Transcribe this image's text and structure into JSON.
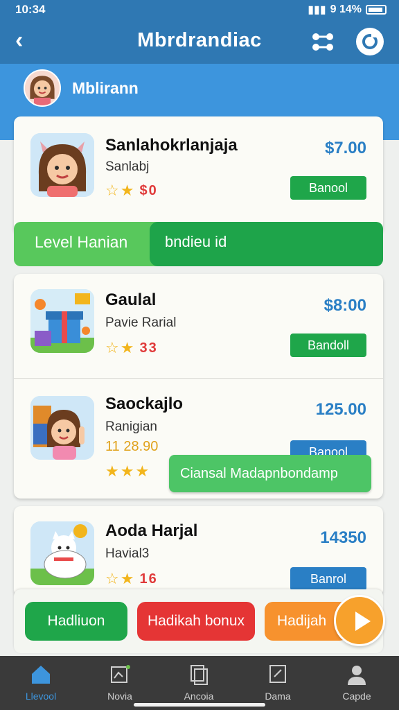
{
  "status": {
    "time": "10:34",
    "indicators": "9 14%"
  },
  "appbar": {
    "title": "Mbrdrandiac",
    "back_icon": "chevron-left-icon",
    "share_icon": "share-icon",
    "refresh_icon": "refresh-icon"
  },
  "profile": {
    "name": "Mblirann"
  },
  "items": [
    {
      "name": "Sanlahokrlanjaja",
      "subtitle": "Sanlabj",
      "price": "$7.00",
      "stars": 2,
      "rating": "$0",
      "button": "Banool"
    },
    {
      "name": "Gaulal",
      "subtitle": "Pavie Rarial",
      "price": "$8:00",
      "stars": 2,
      "rating": "33",
      "button": "Bandoll"
    },
    {
      "name": "Saockajlo",
      "subtitle": "Ranigian",
      "extra": "11 28.90",
      "price": "125.00",
      "stars": 3,
      "button": "Banool"
    },
    {
      "name": "Aoda Harjal",
      "subtitle": "Havial3",
      "price": "14350",
      "stars": 2,
      "rating": "16",
      "button": "Banrol"
    }
  ],
  "level": {
    "label": "Level Hanian",
    "value": "bndieu id"
  },
  "promo": {
    "text": "Ciansal Madapnbondamp"
  },
  "actions": {
    "btn1": "Hadliuon",
    "btn2": "Hadikah bonux",
    "btn3": "Hadijah"
  },
  "nav": [
    {
      "label": "Llevool",
      "icon": "home-icon",
      "active": true
    },
    {
      "label": "Novia",
      "icon": "chart-icon",
      "active": false
    },
    {
      "label": "Ancoia",
      "icon": "copy-icon",
      "active": false
    },
    {
      "label": "Dama",
      "icon": "document-icon",
      "active": false
    },
    {
      "label": "Capde",
      "icon": "user-icon",
      "active": false
    }
  ],
  "colors": {
    "primary": "#2f78b3",
    "accent_blue": "#3d95dd",
    "green": "#1fa64a",
    "red": "#e53535",
    "orange": "#f7922e",
    "star": "#f2b51c"
  }
}
